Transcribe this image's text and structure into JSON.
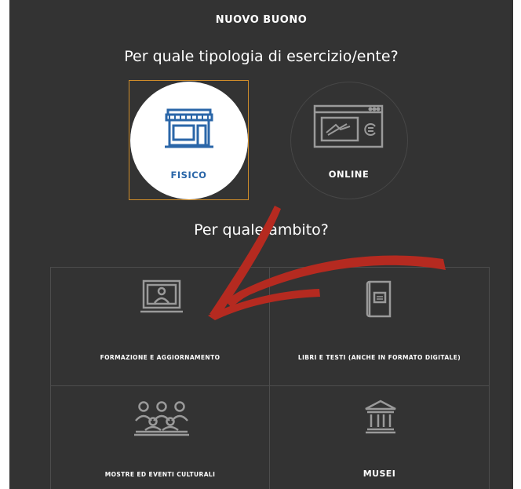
{
  "header": {
    "title": "NUOVO BUONO"
  },
  "questions": {
    "type": "Per quale tipologia di esercizio/ente?",
    "scope": "Per quale ambito?"
  },
  "types": [
    {
      "label": "FISICO",
      "icon": "shop-icon",
      "selected": true
    },
    {
      "label": "ONLINE",
      "icon": "online-payment-icon",
      "selected": false
    }
  ],
  "categories": [
    {
      "label": "FORMAZIONE E AGGIORNAMENTO",
      "icon": "video-lesson-icon"
    },
    {
      "label": "LIBRI E TESTI (ANCHE IN FORMATO DIGITALE)",
      "icon": "book-icon"
    },
    {
      "label": "MOSTRE ED EVENTI CULTURALI",
      "icon": "audience-icon"
    },
    {
      "label": "MUSEI",
      "icon": "museum-icon"
    }
  ],
  "colors": {
    "background": "#333333",
    "selected_border": "#d08d2a",
    "selected_icon": "#2a66a8",
    "annotation_arrow": "#b52a20"
  }
}
